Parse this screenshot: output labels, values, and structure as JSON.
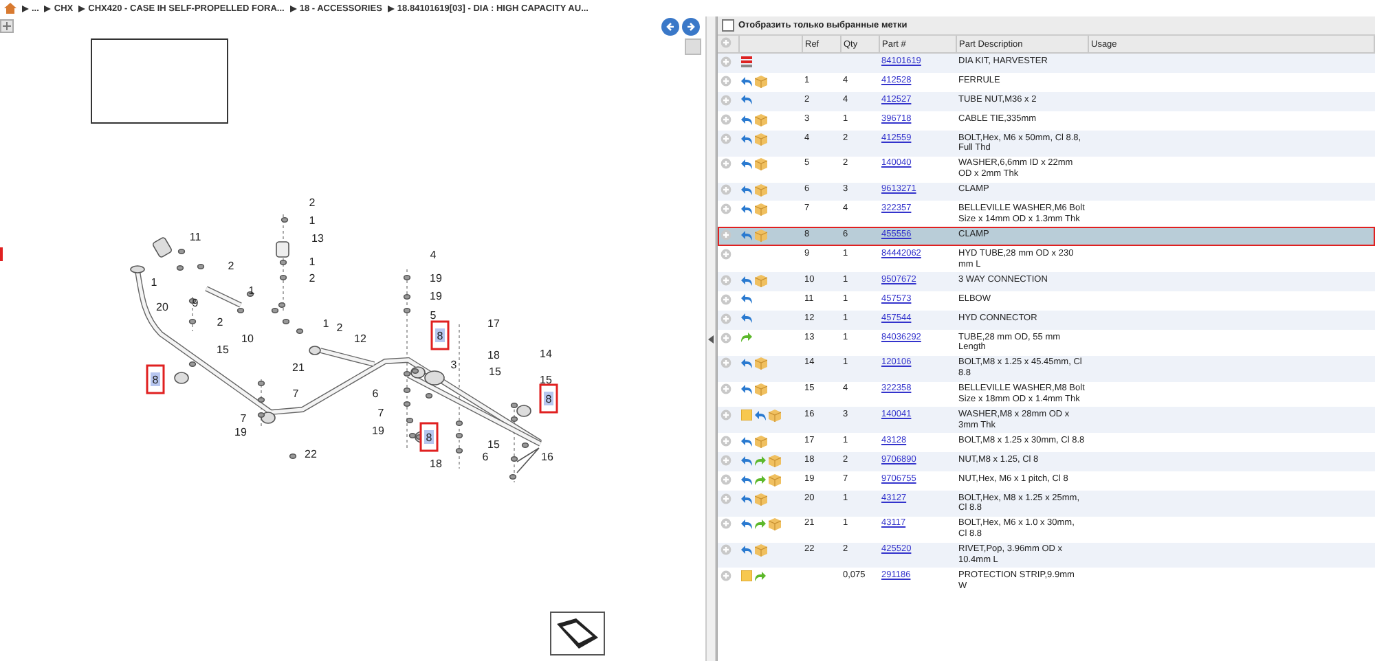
{
  "breadcrumb": [
    "...",
    "CHX",
    "CHX420 - CASE IH SELF-PROPELLED FORA...",
    "18 - ACCESSORIES",
    "18.84101619[03] - DIA : HIGH CAPACITY AU..."
  ],
  "diagram": {
    "callouts": [
      {
        "label": "11",
        "highlighted": false
      },
      {
        "label": "2",
        "highlighted": false
      },
      {
        "label": "1",
        "highlighted": false
      },
      {
        "label": "9",
        "highlighted": false
      },
      {
        "label": "20",
        "highlighted": false
      },
      {
        "label": "2",
        "highlighted": false
      },
      {
        "label": "1",
        "highlighted": false
      },
      {
        "label": "10",
        "highlighted": false
      },
      {
        "label": "15",
        "highlighted": false
      },
      {
        "label": "2",
        "highlighted": false
      },
      {
        "label": "1",
        "highlighted": false
      },
      {
        "label": "13",
        "highlighted": false
      },
      {
        "label": "1",
        "highlighted": false
      },
      {
        "label": "2",
        "highlighted": false
      },
      {
        "label": "1",
        "highlighted": false
      },
      {
        "label": "2",
        "highlighted": false
      },
      {
        "label": "12",
        "highlighted": false
      },
      {
        "label": "21",
        "highlighted": false
      },
      {
        "label": "7",
        "highlighted": false
      },
      {
        "label": "7",
        "highlighted": false
      },
      {
        "label": "19",
        "highlighted": false
      },
      {
        "label": "22",
        "highlighted": false
      },
      {
        "label": "8",
        "highlighted": true
      },
      {
        "label": "4",
        "highlighted": false
      },
      {
        "label": "19",
        "highlighted": false
      },
      {
        "label": "19",
        "highlighted": false
      },
      {
        "label": "5",
        "highlighted": false
      },
      {
        "label": "8",
        "highlighted": true
      },
      {
        "label": "3",
        "highlighted": false
      },
      {
        "label": "6",
        "highlighted": false
      },
      {
        "label": "7",
        "highlighted": false
      },
      {
        "label": "19",
        "highlighted": false
      },
      {
        "label": "8",
        "highlighted": true
      },
      {
        "label": "18",
        "highlighted": false
      },
      {
        "label": "17",
        "highlighted": false
      },
      {
        "label": "18",
        "highlighted": false
      },
      {
        "label": "15",
        "highlighted": false
      },
      {
        "label": "15",
        "highlighted": false
      },
      {
        "label": "6",
        "highlighted": false
      },
      {
        "label": "14",
        "highlighted": false
      },
      {
        "label": "15",
        "highlighted": false
      },
      {
        "label": "8",
        "highlighted": true
      },
      {
        "label": "16",
        "highlighted": false
      }
    ]
  },
  "filter": {
    "label": "Отобразить только выбранные метки",
    "checked": false
  },
  "table": {
    "columns": [
      "Ref",
      "Qty",
      "Part #",
      "Part Description",
      "Usage"
    ],
    "rows": [
      {
        "icons": [
          {
            "kind": "info"
          }
        ],
        "ref": "",
        "qty": "",
        "part": "84101619",
        "description": "DIA KIT, HARVESTER",
        "selected": false
      },
      {
        "icons": [
          {
            "kind": "reply"
          },
          {
            "kind": "box"
          }
        ],
        "ref": "1",
        "qty": "4",
        "part": "412528",
        "description": "FERRULE",
        "selected": false
      },
      {
        "icons": [
          {
            "kind": "reply"
          }
        ],
        "ref": "2",
        "qty": "4",
        "part": "412527",
        "description": "TUBE NUT,M36 x 2",
        "selected": false
      },
      {
        "icons": [
          {
            "kind": "reply"
          },
          {
            "kind": "box"
          }
        ],
        "ref": "3",
        "qty": "1",
        "part": "396718",
        "description": "CABLE TIE,335mm",
        "selected": false
      },
      {
        "icons": [
          {
            "kind": "reply"
          },
          {
            "kind": "box"
          }
        ],
        "ref": "4",
        "qty": "2",
        "part": "412559",
        "description": "BOLT,Hex, M6 x 50mm, Cl 8.8, Full Thd",
        "selected": false
      },
      {
        "icons": [
          {
            "kind": "reply"
          },
          {
            "kind": "box"
          }
        ],
        "ref": "5",
        "qty": "2",
        "part": "140040",
        "description": "WASHER,6,6mm ID x 22mm OD x 2mm Thk",
        "selected": false
      },
      {
        "icons": [
          {
            "kind": "reply"
          },
          {
            "kind": "box"
          }
        ],
        "ref": "6",
        "qty": "3",
        "part": "9613271",
        "description": "CLAMP",
        "selected": false
      },
      {
        "icons": [
          {
            "kind": "reply"
          },
          {
            "kind": "box"
          }
        ],
        "ref": "7",
        "qty": "4",
        "part": "322357",
        "description": "BELLEVILLE WASHER,M6 Bolt Size x 14mm OD x 1.3mm Thk",
        "selected": false
      },
      {
        "icons": [
          {
            "kind": "reply"
          },
          {
            "kind": "box"
          }
        ],
        "ref": "8",
        "qty": "6",
        "part": "455556",
        "description": "CLAMP",
        "selected": true
      },
      {
        "icons": [],
        "ref": "9",
        "qty": "1",
        "part": "84442062",
        "description": "HYD TUBE,28 mm OD x 230 mm L",
        "selected": false
      },
      {
        "icons": [
          {
            "kind": "reply"
          },
          {
            "kind": "box"
          }
        ],
        "ref": "10",
        "qty": "1",
        "part": "9507672",
        "description": "3 WAY CONNECTION",
        "selected": false
      },
      {
        "icons": [
          {
            "kind": "reply"
          }
        ],
        "ref": "11",
        "qty": "1",
        "part": "457573",
        "description": "ELBOW",
        "selected": false
      },
      {
        "icons": [
          {
            "kind": "reply"
          }
        ],
        "ref": "12",
        "qty": "1",
        "part": "457544",
        "description": "HYD CONNECTOR",
        "selected": false
      },
      {
        "icons": [
          {
            "kind": "forward"
          }
        ],
        "ref": "13",
        "qty": "1",
        "part": "84036292",
        "description": "TUBE,28 mm OD, 55 mm Length",
        "selected": false
      },
      {
        "icons": [
          {
            "kind": "reply"
          },
          {
            "kind": "box"
          }
        ],
        "ref": "14",
        "qty": "1",
        "part": "120106",
        "description": "BOLT,M8 x 1.25 x 45.45mm, Cl 8.8",
        "selected": false
      },
      {
        "icons": [
          {
            "kind": "reply"
          },
          {
            "kind": "box"
          }
        ],
        "ref": "15",
        "qty": "4",
        "part": "322358",
        "description": "BELLEVILLE WASHER,M8 Bolt Size x 18mm OD x 1.4mm Thk",
        "selected": false
      },
      {
        "icons": [
          {
            "kind": "note"
          },
          {
            "kind": "reply"
          },
          {
            "kind": "box"
          }
        ],
        "ref": "16",
        "qty": "3",
        "part": "140041",
        "description": "WASHER,M8 x 28mm OD x 3mm Thk",
        "selected": false
      },
      {
        "icons": [
          {
            "kind": "reply"
          },
          {
            "kind": "box"
          }
        ],
        "ref": "17",
        "qty": "1",
        "part": "43128",
        "description": "BOLT,M8 x 1.25 x 30mm, Cl 8.8",
        "selected": false
      },
      {
        "icons": [
          {
            "kind": "reply"
          },
          {
            "kind": "forward"
          },
          {
            "kind": "box"
          }
        ],
        "ref": "18",
        "qty": "2",
        "part": "9706890",
        "description": "NUT,M8 x 1.25, Cl 8",
        "selected": false
      },
      {
        "icons": [
          {
            "kind": "reply"
          },
          {
            "kind": "forward"
          },
          {
            "kind": "box"
          }
        ],
        "ref": "19",
        "qty": "7",
        "part": "9706755",
        "description": "NUT,Hex, M6 x 1 pitch, Cl 8",
        "selected": false
      },
      {
        "icons": [
          {
            "kind": "reply"
          },
          {
            "kind": "box"
          }
        ],
        "ref": "20",
        "qty": "1",
        "part": "43127",
        "description": "BOLT,Hex, M8 x 1.25 x 25mm, Cl 8.8",
        "selected": false
      },
      {
        "icons": [
          {
            "kind": "reply"
          },
          {
            "kind": "forward"
          },
          {
            "kind": "box"
          }
        ],
        "ref": "21",
        "qty": "1",
        "part": "43117",
        "description": "BOLT,Hex, M6 x 1.0 x 30mm, Cl 8.8",
        "selected": false
      },
      {
        "icons": [
          {
            "kind": "reply"
          },
          {
            "kind": "box"
          }
        ],
        "ref": "22",
        "qty": "2",
        "part": "425520",
        "description": "RIVET,Pop, 3.96mm OD x 10.4mm L",
        "selected": false
      },
      {
        "icons": [
          {
            "kind": "note"
          },
          {
            "kind": "forward"
          }
        ],
        "ref": "",
        "qty": "0,075",
        "part": "291186",
        "description": "PROTECTION STRIP,9.9mm W",
        "selected": false
      }
    ]
  }
}
